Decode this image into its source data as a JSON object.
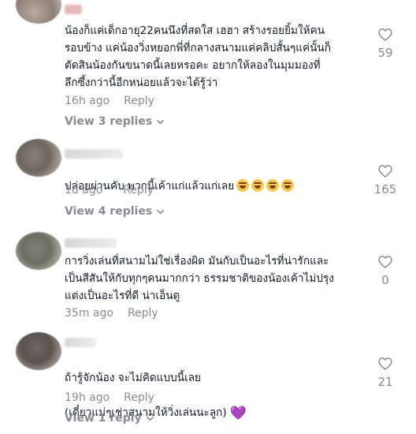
{
  "comments": [
    {
      "text": "น้องก็แค่เด็กอายุ22คนนึงที่สดใส เฮฮา สร้างรอยยิ้มให้คน\nรอบข้าง แค่น้องวิ่งหยอกพี่ที่กลางสนามแค่คลิปสั้นๆแค่นั้นก็\nตัดสินน้องกันขนาดนี้เลยหรอคะ อยากให้ลองในมุมมองที่\nลึกซึ้งกว่านี้อีกหน่อยแล้วจะได้รู้ว่า",
      "time": "16h ago",
      "reply_label": "Reply",
      "view_replies": "View 3 replies",
      "likes": "59"
    },
    {
      "text": "ปล่อยผ่านคับ พวกนี้เค้าแก่แล้วแก่เลย",
      "emoji_count": 4,
      "time": "1d ago",
      "reply_label": "Reply",
      "view_replies": "View 4 replies",
      "likes": "165"
    },
    {
      "text": "การวิ่งเล่นที่สนามไม่ใช่เรื่องผิด มันกับเป็นอะไรที่น่ารักและ\nเป็นสีสันให้กับทุกๆคนมากกว่า ธรรมชาติของน้องเค้าไม่ปรุง\nแต่งเป็นอะไรที่ดี น่าเอ็นดู",
      "time": "35m ago",
      "reply_label": "Reply",
      "likes": "0"
    },
    {
      "text_line1": "ถ้ารู้จักน้อง จะไม่คิดแบบนี้เลย",
      "text_line2": "(เดี๋ยวแม่ๆเช่าสนามให้วิ่งเล่นนะลูก)",
      "emoji": "💜",
      "time": "19h ago",
      "reply_label": "Reply",
      "view_replies": "View 1 reply",
      "likes": "21"
    }
  ],
  "icons": {
    "like": "heart-outline-icon",
    "expand": "chevron-down-icon"
  },
  "colors": {
    "text": "#161823",
    "muted": "#8a8b91",
    "background": "#ffffff"
  }
}
